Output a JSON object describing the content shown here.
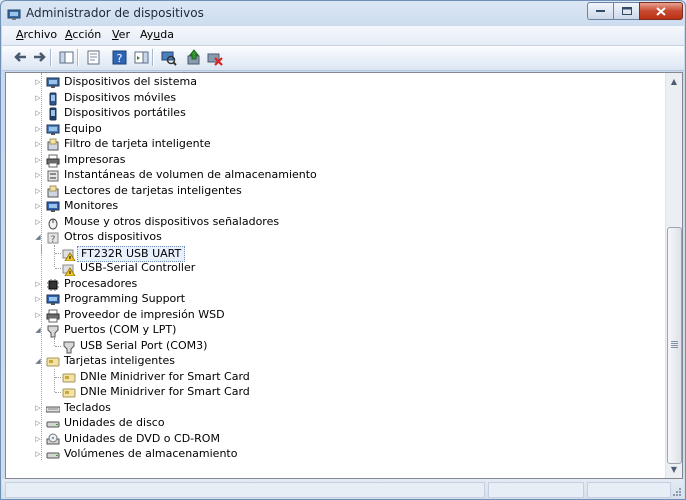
{
  "window": {
    "title": "Administrador de dispositivos"
  },
  "menu": [
    {
      "pre": "",
      "u": "A",
      "post": "rchivo"
    },
    {
      "pre": "",
      "u": "A",
      "post": "cción"
    },
    {
      "pre": "",
      "u": "V",
      "post": "er"
    },
    {
      "pre": "Ay",
      "u": "u",
      "post": "da"
    }
  ],
  "toolbar": {
    "buttons": [
      "back-icon",
      "forward-icon",
      "show-hide-tree-icon",
      "properties-icon",
      "help-icon",
      "show-hide-action-pane-icon",
      "scan-hardware-icon",
      "update-driver-icon",
      "uninstall-device-icon"
    ]
  },
  "tree": [
    {
      "label": "Dispositivos del sistema",
      "level": 1,
      "expanded": false,
      "icon": "system-devices-icon"
    },
    {
      "label": "Dispositivos móviles",
      "level": 1,
      "expanded": false,
      "icon": "mobile-devices-icon"
    },
    {
      "label": "Dispositivos portátiles",
      "level": 1,
      "expanded": false,
      "icon": "portable-devices-icon"
    },
    {
      "label": "Equipo",
      "level": 1,
      "expanded": false,
      "icon": "computer-icon"
    },
    {
      "label": "Filtro de tarjeta inteligente",
      "level": 1,
      "expanded": false,
      "icon": "smart-card-filter-icon"
    },
    {
      "label": "Impresoras",
      "level": 1,
      "expanded": false,
      "icon": "printer-icon"
    },
    {
      "label": "Instantáneas de volumen de almacenamiento",
      "level": 1,
      "expanded": false,
      "icon": "volume-snapshot-icon"
    },
    {
      "label": "Lectores de tarjetas inteligentes",
      "level": 1,
      "expanded": false,
      "icon": "smart-card-reader-icon"
    },
    {
      "label": "Monitores",
      "level": 1,
      "expanded": false,
      "icon": "monitor-icon"
    },
    {
      "label": "Mouse y otros dispositivos señaladores",
      "level": 1,
      "expanded": false,
      "icon": "mouse-icon"
    },
    {
      "label": "Otros dispositivos",
      "level": 1,
      "expanded": true,
      "icon": "other-devices-icon"
    },
    {
      "label": "FT232R USB UART",
      "level": 2,
      "icon": "unknown-device-warning-icon",
      "selected": true
    },
    {
      "label": "USB-Serial Controller",
      "level": 2,
      "icon": "unknown-device-warning-icon"
    },
    {
      "label": "Procesadores",
      "level": 1,
      "expanded": false,
      "icon": "processor-icon"
    },
    {
      "label": "Programming Support",
      "level": 1,
      "expanded": false,
      "icon": "programming-support-icon"
    },
    {
      "label": "Proveedor de impresión WSD",
      "level": 1,
      "expanded": false,
      "icon": "wsd-print-provider-icon"
    },
    {
      "label": "Puertos (COM y LPT)",
      "level": 1,
      "expanded": true,
      "icon": "ports-icon"
    },
    {
      "label": "USB Serial Port (COM3)",
      "level": 2,
      "icon": "port-icon"
    },
    {
      "label": "Tarjetas inteligentes",
      "level": 1,
      "expanded": true,
      "icon": "smart-card-icon"
    },
    {
      "label": "DNIe Minidriver for Smart Card",
      "level": 2,
      "icon": "smart-card-icon"
    },
    {
      "label": "DNIe Minidriver for Smart Card",
      "level": 2,
      "icon": "smart-card-icon"
    },
    {
      "label": "Teclados",
      "level": 1,
      "expanded": false,
      "icon": "keyboard-icon"
    },
    {
      "label": "Unidades de disco",
      "level": 1,
      "expanded": false,
      "icon": "disk-drive-icon"
    },
    {
      "label": "Unidades de DVD o CD-ROM",
      "level": 1,
      "expanded": false,
      "icon": "dvd-drive-icon"
    },
    {
      "label": "Volúmenes de almacenamiento",
      "level": 1,
      "expanded": false,
      "icon": "storage-volume-icon"
    }
  ]
}
